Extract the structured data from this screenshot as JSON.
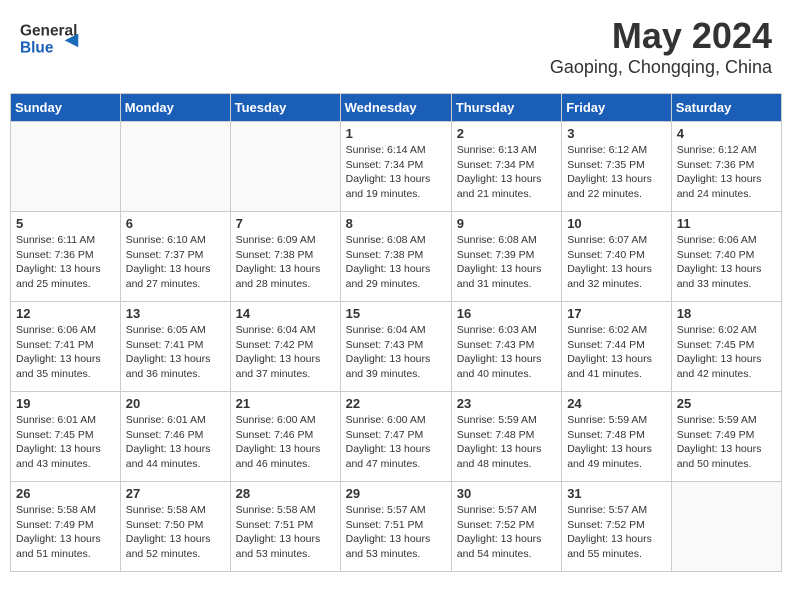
{
  "header": {
    "logo_line1": "General",
    "logo_line2": "Blue",
    "month": "May 2024",
    "location": "Gaoping, Chongqing, China"
  },
  "weekdays": [
    "Sunday",
    "Monday",
    "Tuesday",
    "Wednesday",
    "Thursday",
    "Friday",
    "Saturday"
  ],
  "weeks": [
    [
      {
        "day": "",
        "info": ""
      },
      {
        "day": "",
        "info": ""
      },
      {
        "day": "",
        "info": ""
      },
      {
        "day": "1",
        "info": "Sunrise: 6:14 AM\nSunset: 7:34 PM\nDaylight: 13 hours\nand 19 minutes."
      },
      {
        "day": "2",
        "info": "Sunrise: 6:13 AM\nSunset: 7:34 PM\nDaylight: 13 hours\nand 21 minutes."
      },
      {
        "day": "3",
        "info": "Sunrise: 6:12 AM\nSunset: 7:35 PM\nDaylight: 13 hours\nand 22 minutes."
      },
      {
        "day": "4",
        "info": "Sunrise: 6:12 AM\nSunset: 7:36 PM\nDaylight: 13 hours\nand 24 minutes."
      }
    ],
    [
      {
        "day": "5",
        "info": "Sunrise: 6:11 AM\nSunset: 7:36 PM\nDaylight: 13 hours\nand 25 minutes."
      },
      {
        "day": "6",
        "info": "Sunrise: 6:10 AM\nSunset: 7:37 PM\nDaylight: 13 hours\nand 27 minutes."
      },
      {
        "day": "7",
        "info": "Sunrise: 6:09 AM\nSunset: 7:38 PM\nDaylight: 13 hours\nand 28 minutes."
      },
      {
        "day": "8",
        "info": "Sunrise: 6:08 AM\nSunset: 7:38 PM\nDaylight: 13 hours\nand 29 minutes."
      },
      {
        "day": "9",
        "info": "Sunrise: 6:08 AM\nSunset: 7:39 PM\nDaylight: 13 hours\nand 31 minutes."
      },
      {
        "day": "10",
        "info": "Sunrise: 6:07 AM\nSunset: 7:40 PM\nDaylight: 13 hours\nand 32 minutes."
      },
      {
        "day": "11",
        "info": "Sunrise: 6:06 AM\nSunset: 7:40 PM\nDaylight: 13 hours\nand 33 minutes."
      }
    ],
    [
      {
        "day": "12",
        "info": "Sunrise: 6:06 AM\nSunset: 7:41 PM\nDaylight: 13 hours\nand 35 minutes."
      },
      {
        "day": "13",
        "info": "Sunrise: 6:05 AM\nSunset: 7:41 PM\nDaylight: 13 hours\nand 36 minutes."
      },
      {
        "day": "14",
        "info": "Sunrise: 6:04 AM\nSunset: 7:42 PM\nDaylight: 13 hours\nand 37 minutes."
      },
      {
        "day": "15",
        "info": "Sunrise: 6:04 AM\nSunset: 7:43 PM\nDaylight: 13 hours\nand 39 minutes."
      },
      {
        "day": "16",
        "info": "Sunrise: 6:03 AM\nSunset: 7:43 PM\nDaylight: 13 hours\nand 40 minutes."
      },
      {
        "day": "17",
        "info": "Sunrise: 6:02 AM\nSunset: 7:44 PM\nDaylight: 13 hours\nand 41 minutes."
      },
      {
        "day": "18",
        "info": "Sunrise: 6:02 AM\nSunset: 7:45 PM\nDaylight: 13 hours\nand 42 minutes."
      }
    ],
    [
      {
        "day": "19",
        "info": "Sunrise: 6:01 AM\nSunset: 7:45 PM\nDaylight: 13 hours\nand 43 minutes."
      },
      {
        "day": "20",
        "info": "Sunrise: 6:01 AM\nSunset: 7:46 PM\nDaylight: 13 hours\nand 44 minutes."
      },
      {
        "day": "21",
        "info": "Sunrise: 6:00 AM\nSunset: 7:46 PM\nDaylight: 13 hours\nand 46 minutes."
      },
      {
        "day": "22",
        "info": "Sunrise: 6:00 AM\nSunset: 7:47 PM\nDaylight: 13 hours\nand 47 minutes."
      },
      {
        "day": "23",
        "info": "Sunrise: 5:59 AM\nSunset: 7:48 PM\nDaylight: 13 hours\nand 48 minutes."
      },
      {
        "day": "24",
        "info": "Sunrise: 5:59 AM\nSunset: 7:48 PM\nDaylight: 13 hours\nand 49 minutes."
      },
      {
        "day": "25",
        "info": "Sunrise: 5:59 AM\nSunset: 7:49 PM\nDaylight: 13 hours\nand 50 minutes."
      }
    ],
    [
      {
        "day": "26",
        "info": "Sunrise: 5:58 AM\nSunset: 7:49 PM\nDaylight: 13 hours\nand 51 minutes."
      },
      {
        "day": "27",
        "info": "Sunrise: 5:58 AM\nSunset: 7:50 PM\nDaylight: 13 hours\nand 52 minutes."
      },
      {
        "day": "28",
        "info": "Sunrise: 5:58 AM\nSunset: 7:51 PM\nDaylight: 13 hours\nand 53 minutes."
      },
      {
        "day": "29",
        "info": "Sunrise: 5:57 AM\nSunset: 7:51 PM\nDaylight: 13 hours\nand 53 minutes."
      },
      {
        "day": "30",
        "info": "Sunrise: 5:57 AM\nSunset: 7:52 PM\nDaylight: 13 hours\nand 54 minutes."
      },
      {
        "day": "31",
        "info": "Sunrise: 5:57 AM\nSunset: 7:52 PM\nDaylight: 13 hours\nand 55 minutes."
      },
      {
        "day": "",
        "info": ""
      }
    ]
  ]
}
